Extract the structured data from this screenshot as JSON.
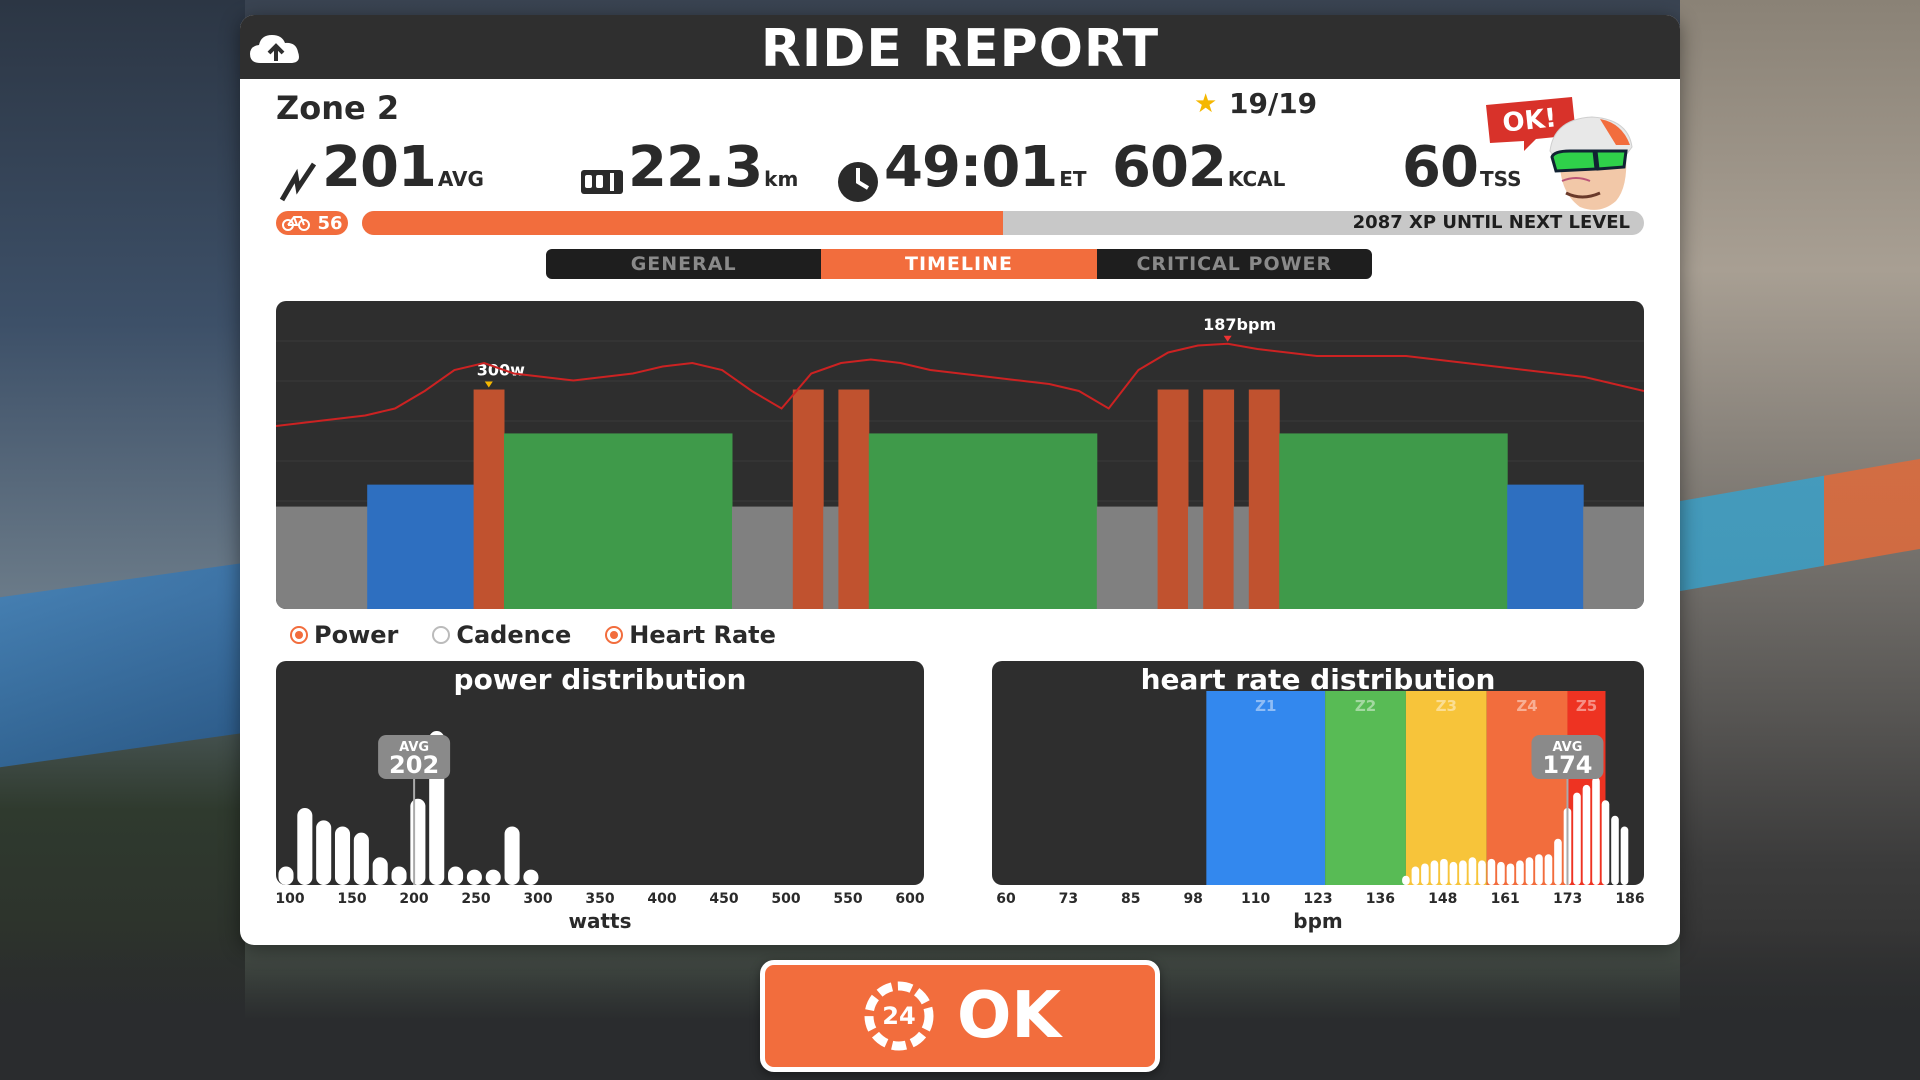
{
  "header": {
    "title": "RIDE REPORT",
    "upload_icon": "cloud-upload-icon"
  },
  "workout": {
    "name": "Zone 2",
    "stars": "19/19"
  },
  "stats": {
    "power": {
      "value": "201",
      "unit": "AVG"
    },
    "distance": {
      "value": "22.3",
      "unit": "km"
    },
    "time": {
      "value": "49:01",
      "unit": "ET"
    },
    "calories": {
      "value": "602",
      "unit": "KCAL"
    },
    "tss": {
      "value": "60",
      "unit": "TSS"
    }
  },
  "ok_bubble": "OK!",
  "level": {
    "value": "56",
    "xp_text": "2087 XP UNTIL NEXT LEVEL",
    "progress": 0.5
  },
  "tabs": [
    {
      "label": "GENERAL",
      "active": false
    },
    {
      "label": "TIMELINE",
      "active": true
    },
    {
      "label": "CRITICAL POWER",
      "active": false
    }
  ],
  "timeline": {
    "hr_peak_label": "187bpm",
    "power_peak_label": "300w",
    "zone_colors": {
      "z1": "#808080",
      "z2": "#2e6fc0",
      "z3": "#3f9a4a",
      "z5": "#c0522f"
    },
    "power_segments": [
      {
        "zone": "z1",
        "watts": 140,
        "duration": 6
      },
      {
        "zone": "z2",
        "watts": 170,
        "duration": 7
      },
      {
        "zone": "z5",
        "watts": 300,
        "duration": 2
      },
      {
        "zone": "z3",
        "watts": 240,
        "duration": 15
      },
      {
        "zone": "z1",
        "watts": 140,
        "duration": 4
      },
      {
        "zone": "z5",
        "watts": 300,
        "duration": 2
      },
      {
        "zone": "z1",
        "watts": 140,
        "duration": 1
      },
      {
        "zone": "z5",
        "watts": 300,
        "duration": 2
      },
      {
        "zone": "z3",
        "watts": 240,
        "duration": 15
      },
      {
        "zone": "z1",
        "watts": 140,
        "duration": 4
      },
      {
        "zone": "z5",
        "watts": 300,
        "duration": 2
      },
      {
        "zone": "z1",
        "watts": 140,
        "duration": 1
      },
      {
        "zone": "z5",
        "watts": 300,
        "duration": 2
      },
      {
        "zone": "z1",
        "watts": 140,
        "duration": 1
      },
      {
        "zone": "z5",
        "watts": 300,
        "duration": 2
      },
      {
        "zone": "z3",
        "watts": 240,
        "duration": 15
      },
      {
        "zone": "z2",
        "watts": 170,
        "duration": 5
      },
      {
        "zone": "z1",
        "watts": 140,
        "duration": 4
      }
    ],
    "heart_rate": [
      140,
      142,
      144,
      146,
      150,
      160,
      172,
      176,
      170,
      168,
      166,
      168,
      170,
      174,
      176,
      172,
      160,
      150,
      170,
      176,
      178,
      176,
      172,
      170,
      168,
      166,
      164,
      160,
      150,
      172,
      182,
      186,
      187,
      184,
      182,
      180,
      180,
      180,
      180,
      178,
      176,
      174,
      172,
      170,
      168,
      164,
      160
    ]
  },
  "legend": [
    {
      "label": "Power",
      "on": true
    },
    {
      "label": "Cadence",
      "on": false
    },
    {
      "label": "Heart Rate",
      "on": true
    }
  ],
  "chart_data": [
    {
      "type": "bar",
      "title": "power distribution",
      "xlabel": "watts",
      "x_ticks": [
        "100",
        "150",
        "200",
        "250",
        "300",
        "350",
        "400",
        "450",
        "500",
        "550",
        "600"
      ],
      "xlim": [
        100,
        600
      ],
      "x": [
        100,
        115,
        130,
        145,
        160,
        175,
        190,
        205,
        220,
        235,
        250,
        265,
        280,
        295
      ],
      "values": [
        0.12,
        0.5,
        0.42,
        0.38,
        0.34,
        0.18,
        0.12,
        0.56,
        1.0,
        0.12,
        0.1,
        0.1,
        0.38,
        0.1
      ],
      "avg_label": "AVG",
      "avg_value": "202",
      "avg_x": 202
    },
    {
      "type": "bar",
      "title": "heart rate distribution",
      "xlabel": "bpm",
      "x_ticks": [
        "60",
        "73",
        "85",
        "98",
        "110",
        "123",
        "136",
        "148",
        "161",
        "173",
        "186"
      ],
      "xlim": [
        55,
        188
      ],
      "zones": [
        {
          "label": "Z1",
          "from": 98,
          "to": 123,
          "color": "#3388ee"
        },
        {
          "label": "Z2",
          "from": 123,
          "to": 140,
          "color": "#58bb55"
        },
        {
          "label": "Z3",
          "from": 140,
          "to": 157,
          "color": "#f7c43a"
        },
        {
          "label": "Z4",
          "from": 157,
          "to": 174,
          "color": "#f26d3d"
        },
        {
          "label": "Z5",
          "from": 174,
          "to": 182,
          "color": "#ee3322"
        }
      ],
      "x": [
        140,
        142,
        144,
        146,
        148,
        150,
        152,
        154,
        156,
        158,
        160,
        162,
        164,
        166,
        168,
        170,
        172,
        174,
        176,
        178,
        180,
        182,
        184,
        186
      ],
      "values": [
        0.06,
        0.12,
        0.14,
        0.16,
        0.17,
        0.15,
        0.16,
        0.18,
        0.16,
        0.17,
        0.15,
        0.14,
        0.16,
        0.18,
        0.2,
        0.2,
        0.3,
        0.5,
        0.6,
        0.65,
        0.7,
        0.55,
        0.45,
        0.38
      ],
      "avg_label": "AVG",
      "avg_value": "174",
      "avg_x": 174
    }
  ],
  "ok_button": {
    "label": "OK",
    "badge": "24"
  }
}
